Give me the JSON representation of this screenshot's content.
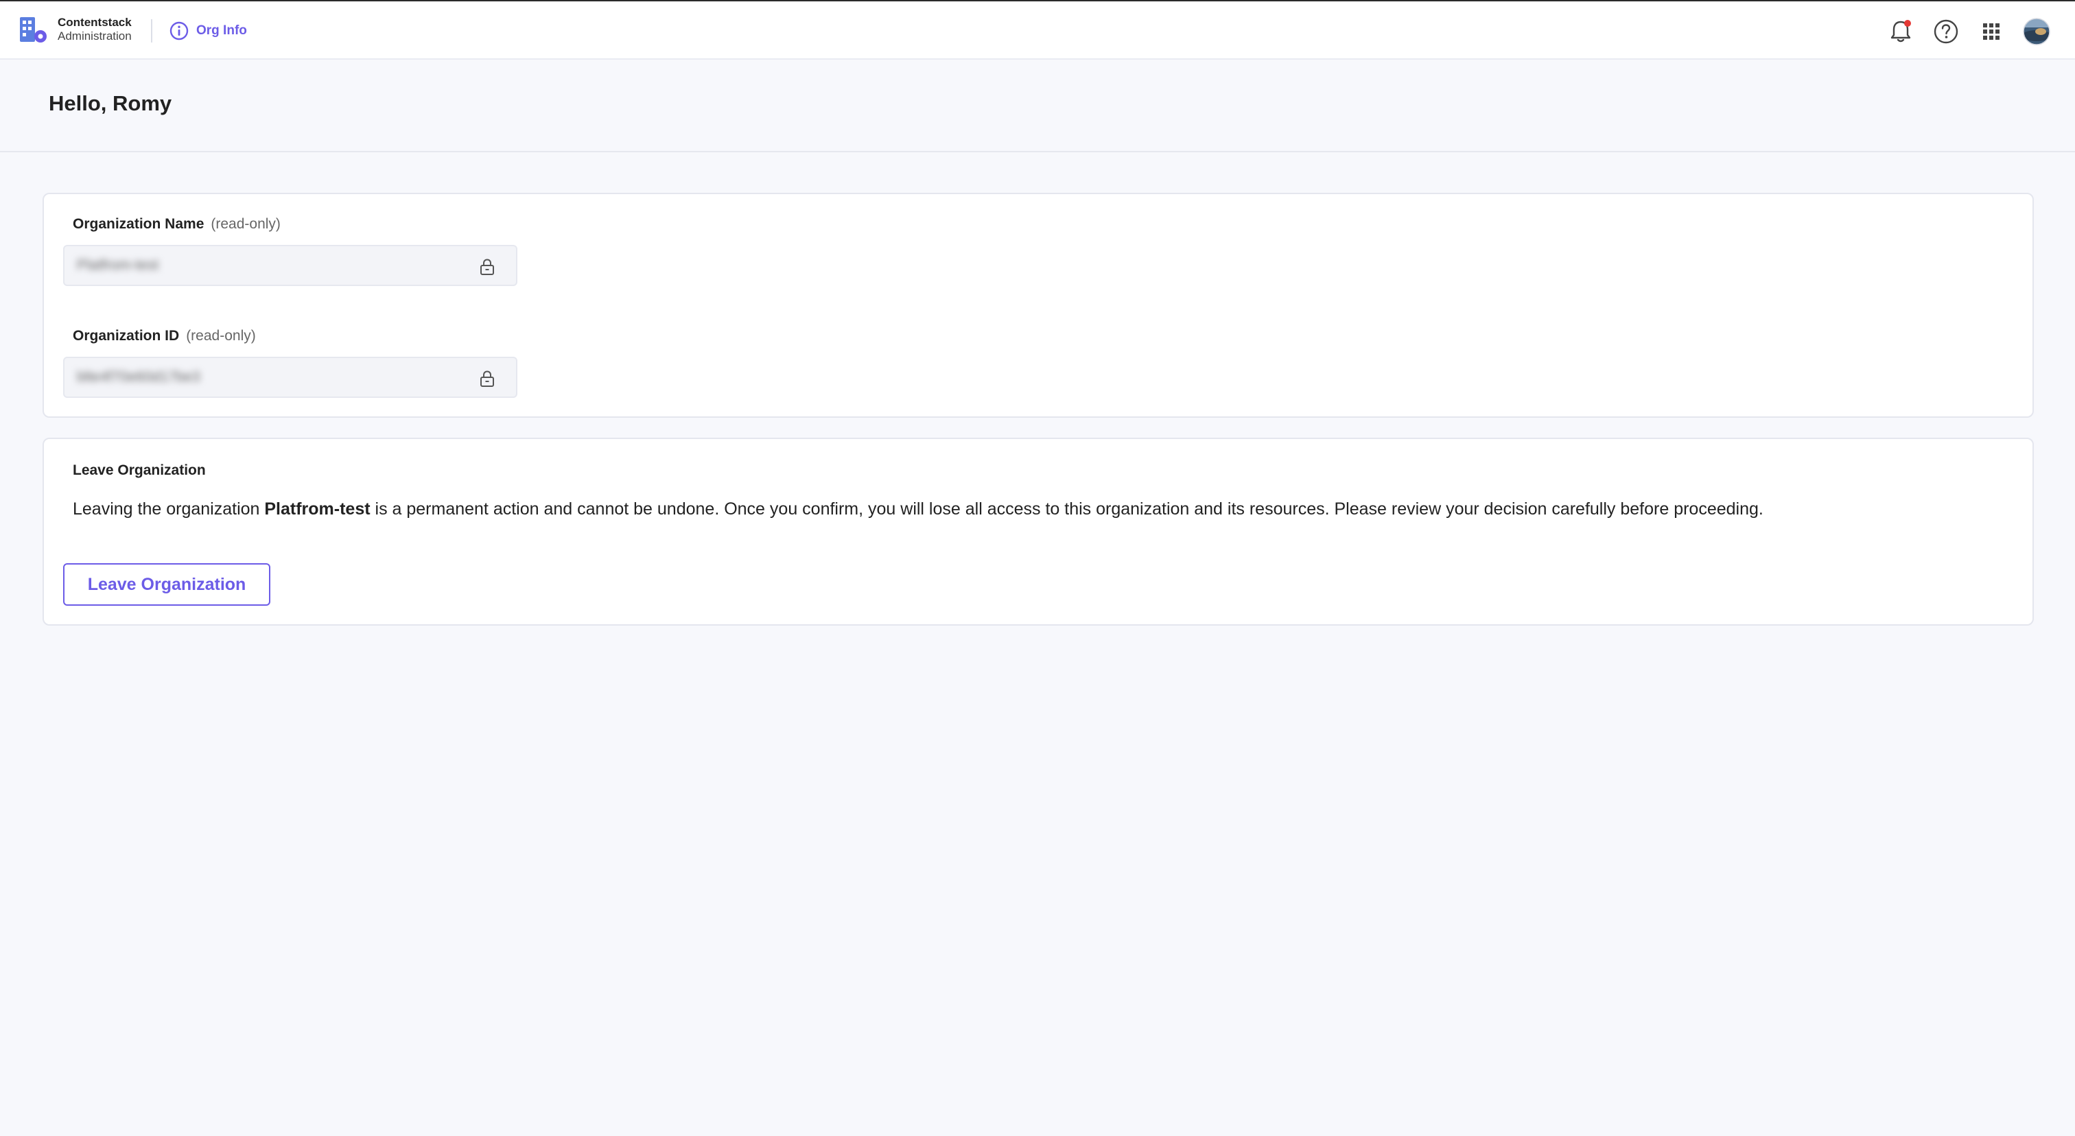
{
  "brand": {
    "name": "Contentstack",
    "sub": "Administration"
  },
  "nav": {
    "org_info_label": "Org Info"
  },
  "top_icons": [
    "bell-icon",
    "help-icon",
    "apps-grid-icon",
    "user-avatar"
  ],
  "colors": {
    "accent": "#6c5ce7",
    "notification_dot": "#e53935",
    "background": "#f7f8fc"
  },
  "page": {
    "title": "Hello, Romy"
  },
  "org_fields": {
    "name": {
      "label": "Organization Name",
      "suffix": "(read-only)",
      "value": "Platfrom-test"
    },
    "id": {
      "label": "Organization ID",
      "suffix": "(read-only)",
      "value": "blte4f70e60d17be3"
    }
  },
  "leave": {
    "title": "Leave Organization",
    "desc_pre": "Leaving the organization ",
    "org_name": "Platfrom-test",
    "desc_post": " is a permanent action and cannot be undone. Once you confirm, you will lose all access to this organization and its resources. Please review your decision carefully before proceeding.",
    "button_label": "Leave Organization"
  }
}
